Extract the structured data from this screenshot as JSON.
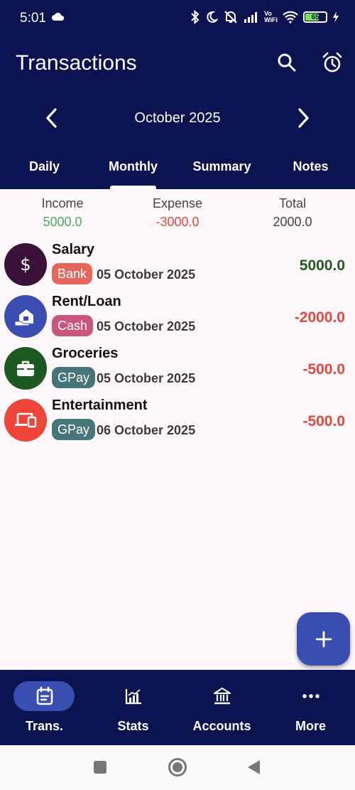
{
  "status_bar": {
    "time": "5:01",
    "battery": "65"
  },
  "header": {
    "title": "Transactions",
    "search_icon": "search-icon",
    "alarm_icon": "alarm-icon",
    "month": "October 2025"
  },
  "tabs": [
    {
      "label": "Daily"
    },
    {
      "label": "Monthly"
    },
    {
      "label": "Summary"
    },
    {
      "label": "Notes"
    }
  ],
  "active_tab": "Monthly",
  "summary": {
    "income_label": "Income",
    "income_value": "5000.0",
    "expense_label": "Expense",
    "expense_value": "-3000.0",
    "total_label": "Total",
    "total_value": "2000.0"
  },
  "transactions": [
    {
      "title": "Salary",
      "account": "Bank",
      "date": "05 October 2025",
      "amount": "5000.0",
      "icon": "dollar-icon",
      "icon_color": "#3a1139",
      "chip_color": "#e8675d",
      "amount_color": "#1e5d1e"
    },
    {
      "title": "Rent/Loan",
      "account": "Cash",
      "date": "05 October 2025",
      "amount": "-2000.0",
      "icon": "home-loan-icon",
      "icon_color": "#3a4db0",
      "chip_color": "#c8567b",
      "amount_color": "#e4483c"
    },
    {
      "title": "Groceries",
      "account": "GPay",
      "date": "05 October 2025",
      "amount": "-500.0",
      "icon": "briefcase-icon",
      "icon_color": "#1d5a22",
      "chip_color": "#47767a",
      "amount_color": "#e4483c"
    },
    {
      "title": "Entertainment",
      "account": "GPay",
      "date": "06 October 2025",
      "amount": "-500.0",
      "icon": "devices-icon",
      "icon_color": "#ef4538",
      "chip_color": "#47767a",
      "amount_color": "#e4483c"
    }
  ],
  "colors": {
    "income": "#4caf50",
    "expense": "#e4483c",
    "total": "#444444",
    "header_bg": "#0b1451",
    "accent": "#3a4db0"
  },
  "bottom_nav": [
    {
      "label": "Trans.",
      "icon": "calendar-icon"
    },
    {
      "label": "Stats",
      "icon": "chart-icon"
    },
    {
      "label": "Accounts",
      "icon": "bank-icon"
    },
    {
      "label": "More",
      "icon": "more-icon"
    }
  ]
}
